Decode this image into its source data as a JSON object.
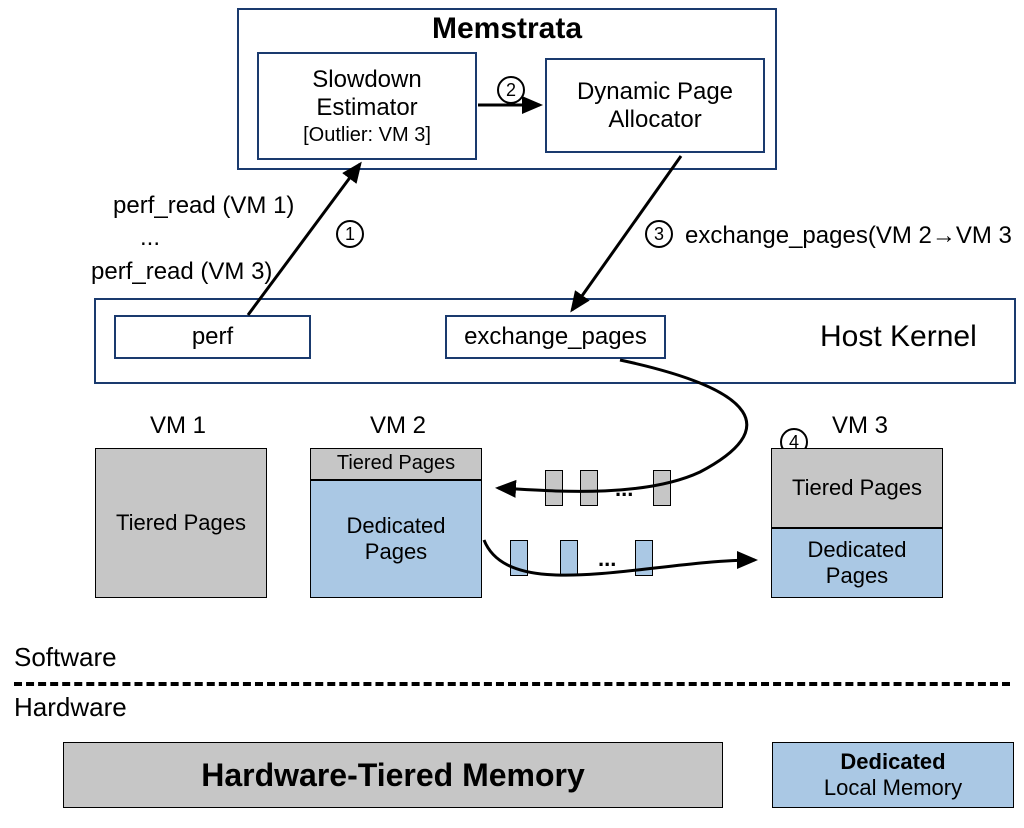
{
  "memstrata": {
    "title": "Memstrata",
    "slowdown": {
      "line1": "Slowdown",
      "line2": "Estimator",
      "outlier": "[Outlier: VM 3]"
    },
    "allocator": {
      "line1": "Dynamic Page",
      "line2": "Allocator"
    }
  },
  "steps": {
    "s1": "1",
    "s2": "2",
    "s3": "3",
    "s4": "4"
  },
  "calls": {
    "perf_read1": "perf_read (VM 1)",
    "perf_dots": "...",
    "perf_read3": "perf_read (VM 3)",
    "exchange_call": "exchange_pages(VM 2→VM 3"
  },
  "host_kernel": {
    "title": "Host Kernel",
    "perf": "perf",
    "exchange": "exchange_pages"
  },
  "vms": {
    "vm1": {
      "label": "VM 1",
      "tier": "Tiered Pages"
    },
    "vm2": {
      "label": "VM 2",
      "tier": "Tiered Pages",
      "ded": "Dedicated\nPages"
    },
    "vm3": {
      "label": "VM 3",
      "tier": "Tiered Pages",
      "ded": "Dedicated\nPages"
    }
  },
  "chips_dots": "...",
  "layers": {
    "software": "Software",
    "hardware": "Hardware"
  },
  "hw": {
    "tiered": "Hardware-Tiered Memory",
    "dedicated_top": "Dedicated",
    "dedicated_bot": "Local Memory"
  }
}
